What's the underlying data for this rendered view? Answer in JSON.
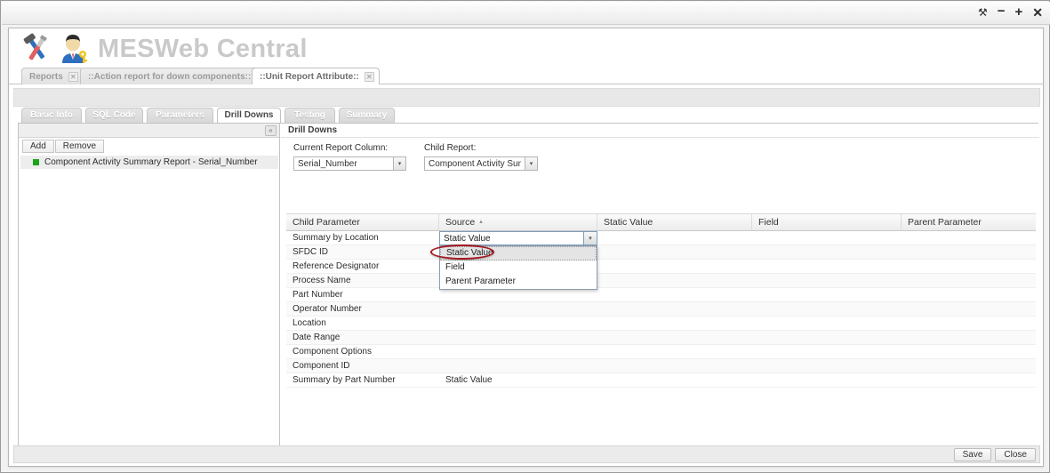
{
  "window": {
    "controls": [
      {
        "name": "wrench-icon",
        "glyph": "⚒"
      },
      {
        "name": "minimize-icon",
        "glyph": "−"
      },
      {
        "name": "maximize-icon",
        "glyph": "+"
      },
      {
        "name": "close-icon",
        "glyph": "✕"
      }
    ]
  },
  "brand": {
    "title": "MESWeb Central"
  },
  "doc_tabs": [
    {
      "label": "Reports",
      "close": "✕",
      "active": false
    },
    {
      "label": "::Action report for down components::",
      "close": "✕",
      "active": false
    },
    {
      "label": "::Unit Report Attribute::",
      "close": "✕",
      "active": true
    }
  ],
  "section_tabs": [
    {
      "label": "Basic Info",
      "active": false
    },
    {
      "label": "SQL Code",
      "active": false
    },
    {
      "label": "Parameters",
      "active": false
    },
    {
      "label": "Drill Downs",
      "active": true
    },
    {
      "label": "Testing",
      "active": false
    },
    {
      "label": "Summary",
      "active": false
    }
  ],
  "left_pane": {
    "collapse_glyph": "«",
    "buttons": [
      "Add",
      "Remove"
    ],
    "tree_items": [
      {
        "label": "Component Activity Summary Report - Serial_Number",
        "color": "#1aa51a"
      }
    ]
  },
  "right_pane": {
    "header": "Drill Downs",
    "fields": [
      {
        "label": "Current Report Column:",
        "value": "Serial_Number",
        "arrow": "▾"
      },
      {
        "label": "Child Report:",
        "value": "Component Activity Sum",
        "arrow": "▾"
      }
    ],
    "grid": {
      "columns": [
        {
          "label": "Child Parameter",
          "sorted": false
        },
        {
          "label": "Source",
          "sorted": true,
          "sort_glyph": "▴"
        },
        {
          "label": "Static Value",
          "sorted": false
        },
        {
          "label": "Field",
          "sorted": false
        },
        {
          "label": "Parent Parameter",
          "sorted": false
        }
      ],
      "rows": [
        {
          "child_parameter": "Summary by Location",
          "source": "",
          "static_value": "",
          "field": "",
          "parent_parameter": ""
        },
        {
          "child_parameter": "SFDC ID",
          "source": "",
          "static_value": "",
          "field": "",
          "parent_parameter": ""
        },
        {
          "child_parameter": "Reference Designator",
          "source": "",
          "static_value": "",
          "field": "",
          "parent_parameter": ""
        },
        {
          "child_parameter": "Process Name",
          "source": "",
          "static_value": "",
          "field": "",
          "parent_parameter": ""
        },
        {
          "child_parameter": "Part Number",
          "source": "",
          "static_value": "",
          "field": "",
          "parent_parameter": ""
        },
        {
          "child_parameter": "Operator Number",
          "source": "",
          "static_value": "",
          "field": "",
          "parent_parameter": ""
        },
        {
          "child_parameter": "Location",
          "source": "",
          "static_value": "",
          "field": "",
          "parent_parameter": ""
        },
        {
          "child_parameter": "Date Range",
          "source": "",
          "static_value": "",
          "field": "",
          "parent_parameter": ""
        },
        {
          "child_parameter": "Component Options",
          "source": "",
          "static_value": "",
          "field": "",
          "parent_parameter": ""
        },
        {
          "child_parameter": "Component ID",
          "source": "",
          "static_value": "",
          "field": "",
          "parent_parameter": ""
        },
        {
          "child_parameter": "Summary by Part Number",
          "source": "Static Value",
          "static_value": "",
          "field": "",
          "parent_parameter": ""
        }
      ],
      "editor": {
        "value": "Static Value",
        "arrow": "▾",
        "options": [
          "Static Value",
          "Field",
          "Parent Parameter"
        ],
        "selected_index": 0
      }
    }
  },
  "annotation": {
    "color": "#a4171f",
    "target": "Static Value"
  },
  "footer": {
    "buttons": [
      "Save",
      "Close"
    ]
  }
}
